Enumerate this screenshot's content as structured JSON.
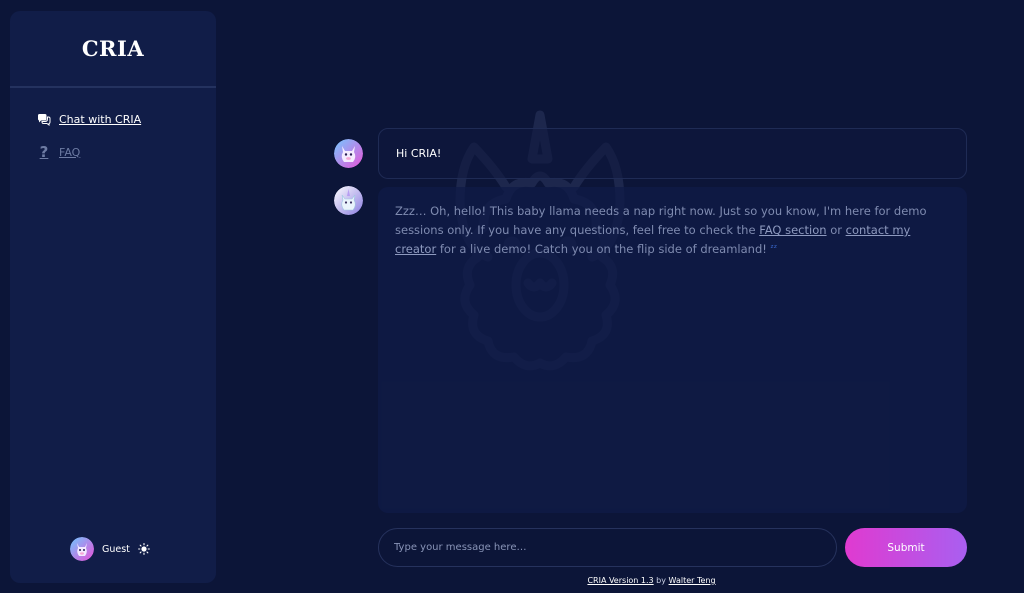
{
  "sidebar": {
    "brand": "CRIA",
    "items": [
      {
        "label": "Chat with CRIA",
        "icon": "chat-bubbles-icon"
      },
      {
        "label": "FAQ",
        "icon": "question-mark-icon"
      }
    ],
    "user": {
      "name": "Guest",
      "avatar_icon": "llama-avatar-icon",
      "theme_toggle_icon": "sun-icon"
    }
  },
  "chat": {
    "messages": [
      {
        "role": "user",
        "text": "Hi CRIA!"
      },
      {
        "role": "assistant",
        "text_parts": {
          "p1": "Zzz… Oh, hello! This baby llama needs a nap right now. Just so you know, I'm here for demo sessions only. If you have any questions, feel free to check the ",
          "link1": "FAQ section",
          "p2": " or ",
          "link2": "contact my creator",
          "p3": " for a live demo! Catch you on the flip side of dreamland! ",
          "zz": "ᶻᶻ"
        }
      }
    ],
    "input": {
      "placeholder": "Type your message here…",
      "value": ""
    },
    "submit_label": "Submit"
  },
  "footer": {
    "version": "CRIA Version 1.3",
    "by": " by ",
    "author": "Walter Teng"
  },
  "colors": {
    "background": "#0c1538",
    "sidebar": "#111d48",
    "accent_start": "#e03ad0",
    "accent_end": "#a95ff0"
  }
}
